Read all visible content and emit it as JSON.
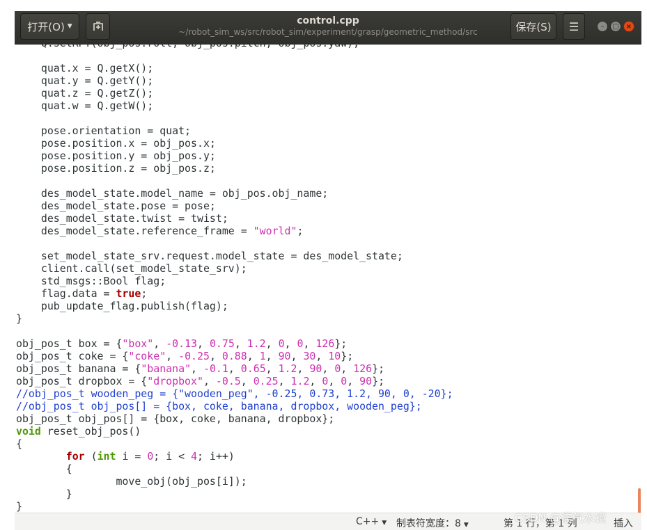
{
  "header": {
    "open_label": "打开(O)",
    "title": "control.cpp",
    "path": "~/robot_sim_ws/src/robot_sim/experiment/grasp/geometric_method/src",
    "save_label": "保存(S)",
    "menu_icon": "hamburger-menu-icon"
  },
  "editor": {
    "language": "C++",
    "lines": [
      [
        [
          "t",
          "    Q.setRPY(obj_pos.roll, obj_pos.pitch, obj_pos.yaw);"
        ]
      ],
      [
        [
          "t",
          ""
        ]
      ],
      [
        [
          "t",
          "    quat.x = Q.getX();"
        ]
      ],
      [
        [
          "t",
          "    quat.y = Q.getY();"
        ]
      ],
      [
        [
          "t",
          "    quat.z = Q.getZ();"
        ]
      ],
      [
        [
          "t",
          "    quat.w = Q.getW();"
        ]
      ],
      [
        [
          "t",
          ""
        ]
      ],
      [
        [
          "t",
          "    pose.orientation = quat;"
        ]
      ],
      [
        [
          "t",
          "    pose.position.x = obj_pos.x;"
        ]
      ],
      [
        [
          "t",
          "    pose.position.y = obj_pos.y;"
        ]
      ],
      [
        [
          "t",
          "    pose.position.z = obj_pos.z;"
        ]
      ],
      [
        [
          "t",
          ""
        ]
      ],
      [
        [
          "t",
          "    des_model_state.model_name = obj_pos.obj_name;"
        ]
      ],
      [
        [
          "t",
          "    des_model_state.pose = pose;"
        ]
      ],
      [
        [
          "t",
          "    des_model_state.twist = twist;"
        ]
      ],
      [
        [
          "t",
          "    des_model_state.reference_frame = "
        ],
        [
          "st",
          "\"world\""
        ],
        [
          "t",
          ";"
        ]
      ],
      [
        [
          "t",
          ""
        ]
      ],
      [
        [
          "t",
          "    set_model_state_srv.request.model_state = des_model_state;"
        ]
      ],
      [
        [
          "t",
          "    client.call(set_model_state_srv);"
        ]
      ],
      [
        [
          "t",
          "    std_msgs::Bool flag;"
        ]
      ],
      [
        [
          "t",
          "    flag.data = "
        ],
        [
          "kw",
          "true"
        ],
        [
          "t",
          ";"
        ]
      ],
      [
        [
          "t",
          "    pub_update_flag.publish(flag);"
        ]
      ],
      [
        [
          "t",
          "}"
        ]
      ],
      [
        [
          "t",
          ""
        ]
      ],
      [
        [
          "t",
          "obj_pos_t box = {"
        ],
        [
          "st",
          "\"box\""
        ],
        [
          "t",
          ", "
        ],
        [
          "nm",
          "-0.13"
        ],
        [
          "t",
          ", "
        ],
        [
          "nm",
          "0.75"
        ],
        [
          "t",
          ", "
        ],
        [
          "nm",
          "1.2"
        ],
        [
          "t",
          ", "
        ],
        [
          "nm",
          "0"
        ],
        [
          "t",
          ", "
        ],
        [
          "nm",
          "0"
        ],
        [
          "t",
          ", "
        ],
        [
          "nm",
          "126"
        ],
        [
          "t",
          "};"
        ]
      ],
      [
        [
          "t",
          "obj_pos_t coke = {"
        ],
        [
          "st",
          "\"coke\""
        ],
        [
          "t",
          ", "
        ],
        [
          "nm",
          "-0.25"
        ],
        [
          "t",
          ", "
        ],
        [
          "nm",
          "0.88"
        ],
        [
          "t",
          ", "
        ],
        [
          "nm",
          "1"
        ],
        [
          "t",
          ", "
        ],
        [
          "nm",
          "90"
        ],
        [
          "t",
          ", "
        ],
        [
          "nm",
          "30"
        ],
        [
          "t",
          ", "
        ],
        [
          "nm",
          "10"
        ],
        [
          "t",
          "};"
        ]
      ],
      [
        [
          "t",
          "obj_pos_t banana = {"
        ],
        [
          "st",
          "\"banana\""
        ],
        [
          "t",
          ", "
        ],
        [
          "nm",
          "-0.1"
        ],
        [
          "t",
          ", "
        ],
        [
          "nm",
          "0.65"
        ],
        [
          "t",
          ", "
        ],
        [
          "nm",
          "1.2"
        ],
        [
          "t",
          ", "
        ],
        [
          "nm",
          "90"
        ],
        [
          "t",
          ", "
        ],
        [
          "nm",
          "0"
        ],
        [
          "t",
          ", "
        ],
        [
          "nm",
          "126"
        ],
        [
          "t",
          "};"
        ]
      ],
      [
        [
          "t",
          "obj_pos_t dropbox = {"
        ],
        [
          "st",
          "\"dropbox\""
        ],
        [
          "t",
          ", "
        ],
        [
          "nm",
          "-0.5"
        ],
        [
          "t",
          ", "
        ],
        [
          "nm",
          "0.25"
        ],
        [
          "t",
          ", "
        ],
        [
          "nm",
          "1.2"
        ],
        [
          "t",
          ", "
        ],
        [
          "nm",
          "0"
        ],
        [
          "t",
          ", "
        ],
        [
          "nm",
          "0"
        ],
        [
          "t",
          ", "
        ],
        [
          "nm",
          "90"
        ],
        [
          "t",
          "};"
        ]
      ],
      [
        [
          "cm",
          "//obj_pos_t wooden_peg = {\"wooden_peg\", -0.25, 0.73, 1.2, 90, 0, -20};"
        ]
      ],
      [
        [
          "cm",
          "//obj_pos_t obj_pos[] = {box, coke, banana, dropbox, wooden_peg};"
        ]
      ],
      [
        [
          "t",
          "obj_pos_t obj_pos[] = {box, coke, banana, dropbox};"
        ]
      ],
      [
        [
          "ty",
          "void"
        ],
        [
          "t",
          " reset_obj_pos()"
        ]
      ],
      [
        [
          "t",
          "{"
        ]
      ],
      [
        [
          "t",
          "        "
        ],
        [
          "kw",
          "for"
        ],
        [
          "t",
          " ("
        ],
        [
          "ty",
          "int"
        ],
        [
          "t",
          " i = "
        ],
        [
          "nm",
          "0"
        ],
        [
          "t",
          "; i < "
        ],
        [
          "nm",
          "4"
        ],
        [
          "t",
          "; i++)"
        ]
      ],
      [
        [
          "t",
          "        {"
        ]
      ],
      [
        [
          "t",
          "                move_obj(obj_pos[i]);"
        ]
      ],
      [
        [
          "t",
          "        }"
        ]
      ],
      [
        [
          "t",
          "}"
        ]
      ]
    ]
  },
  "statusbar": {
    "language": "C++",
    "tab_width": "制表符宽度：8",
    "position": "第 1 行，第 1 列",
    "mode": "插入"
  },
  "watermark": "CSDN @濡气水镜"
}
